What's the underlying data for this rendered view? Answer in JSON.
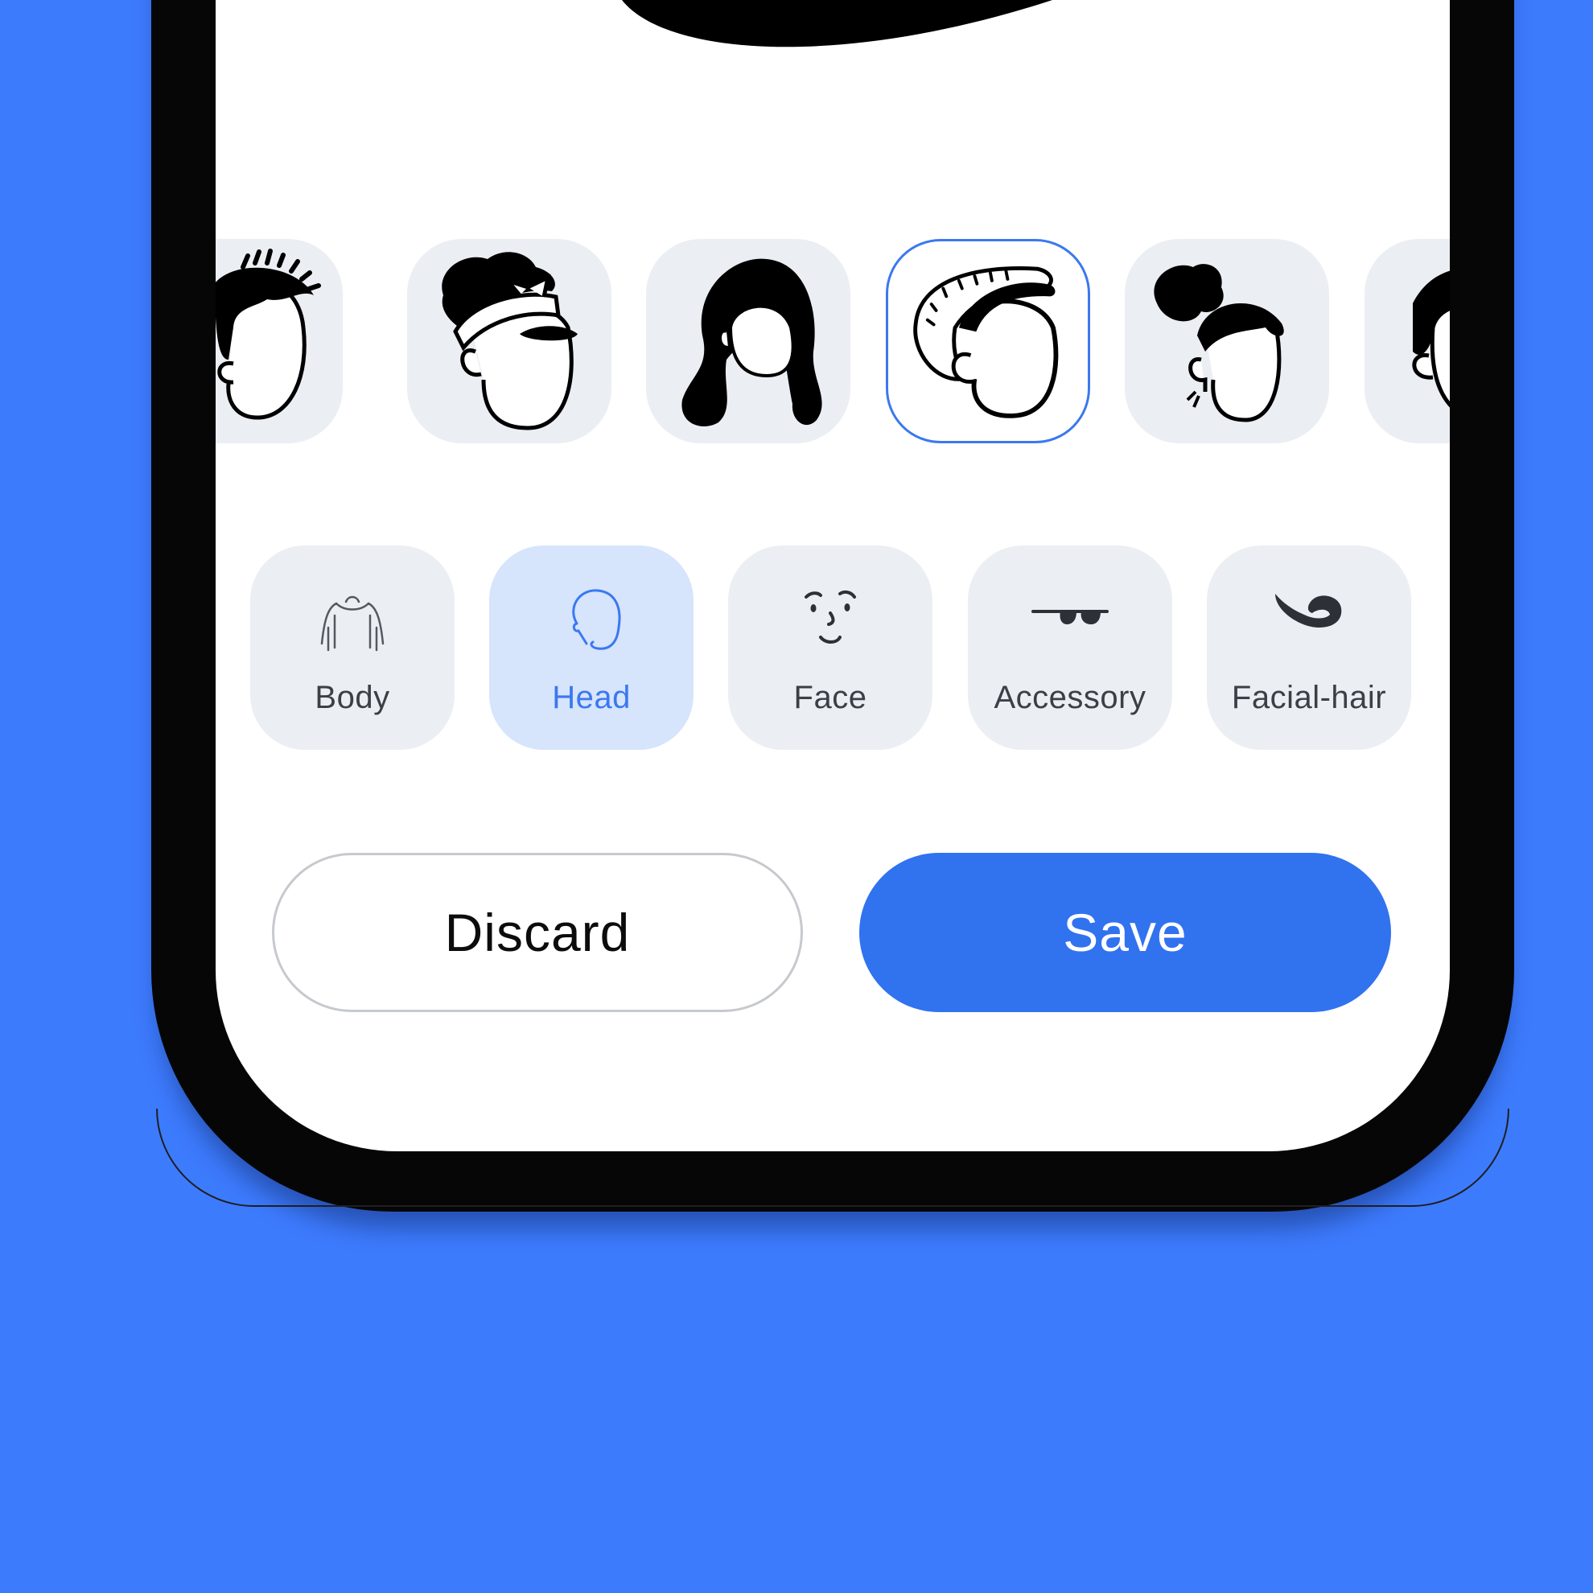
{
  "hair_options": [
    {
      "icon": "hair-short-curly-icon",
      "selected": false
    },
    {
      "icon": "hair-bandana-icon",
      "selected": false
    },
    {
      "icon": "hair-long-wavy-icon",
      "selected": false
    },
    {
      "icon": "hair-beanie-icon",
      "selected": true
    },
    {
      "icon": "hair-puff-bun-icon",
      "selected": false
    },
    {
      "icon": "hair-short-icon",
      "selected": false
    }
  ],
  "categories": [
    {
      "label": "Body",
      "icon": "body-icon",
      "active": false
    },
    {
      "label": "Head",
      "icon": "head-icon",
      "active": true
    },
    {
      "label": "Face",
      "icon": "face-icon",
      "active": false
    },
    {
      "label": "Accessory",
      "icon": "sunglasses-icon",
      "active": false
    },
    {
      "label": "Facial-hair",
      "icon": "mustache-icon",
      "active": false
    }
  ],
  "actions": {
    "discard_label": "Discard",
    "save_label": "Save"
  },
  "colors": {
    "background": "#3d7bfd",
    "accent": "#3172ef",
    "tile": "#ebeef3",
    "tile_active": "#d6e4fc",
    "selected_border": "#3b78f0"
  }
}
